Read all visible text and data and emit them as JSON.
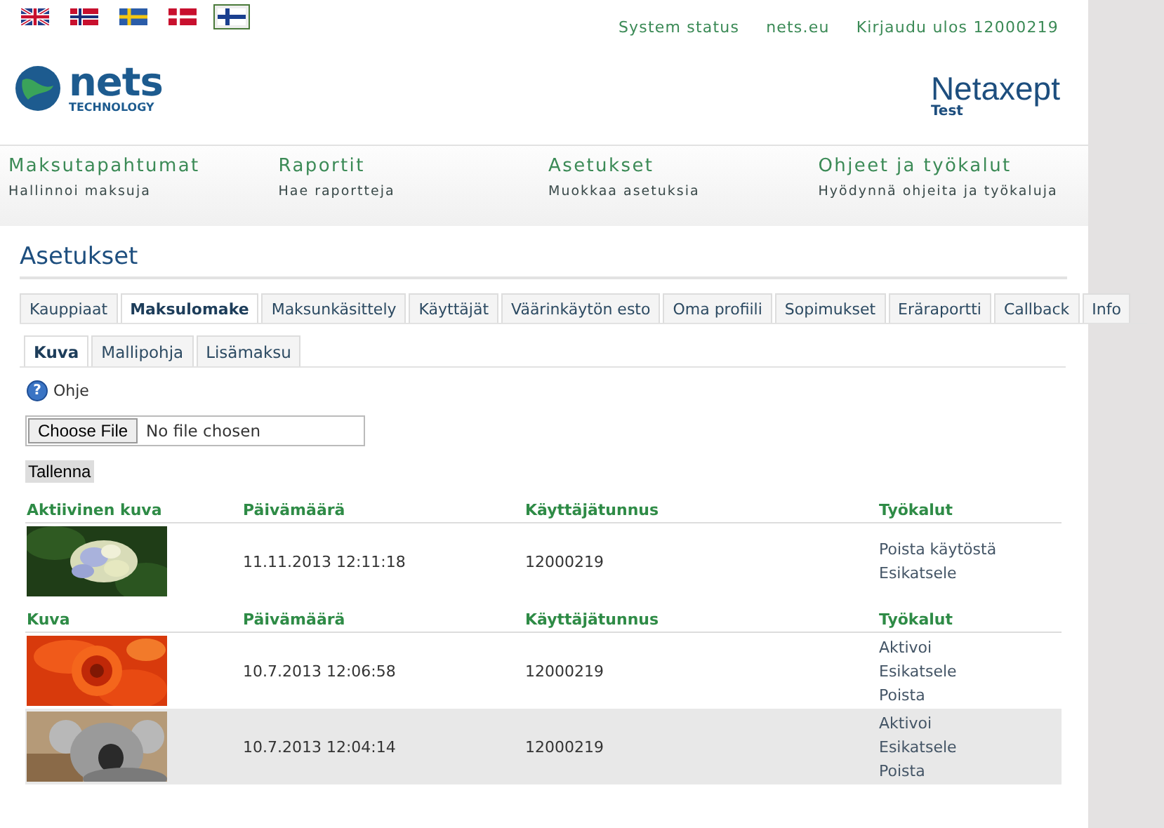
{
  "languages": [
    {
      "kind": "uk",
      "selected": false
    },
    {
      "kind": "no",
      "selected": false
    },
    {
      "kind": "se",
      "selected": false
    },
    {
      "kind": "dk",
      "selected": false
    },
    {
      "kind": "fi",
      "selected": true
    }
  ],
  "top_links": [
    "System status",
    "nets.eu",
    "Kirjaudu ulos 12000219"
  ],
  "logo": {
    "name": "nets",
    "sub": "TECHNOLOGY"
  },
  "product": {
    "name": "Netaxept",
    "env": "Test"
  },
  "nav": [
    {
      "title": "Maksutapahtumat",
      "subtitle": "Hallinnoi maksuja"
    },
    {
      "title": "Raportit",
      "subtitle": "Hae raportteja"
    },
    {
      "title": "Asetukset",
      "subtitle": "Muokkaa asetuksia"
    },
    {
      "title": "Ohjeet ja työkalut",
      "subtitle": "Hyödynnä ohjeita ja työkaluja"
    }
  ],
  "page_title": "Asetukset",
  "tabs": [
    {
      "label": "Kauppiaat",
      "selected": false
    },
    {
      "label": "Maksulomake",
      "selected": true
    },
    {
      "label": "Maksunkäsittely",
      "selected": false
    },
    {
      "label": "Käyttäjät",
      "selected": false
    },
    {
      "label": "Väärinkäytön esto",
      "selected": false
    },
    {
      "label": "Oma profiili",
      "selected": false
    },
    {
      "label": "Sopimukset",
      "selected": false
    },
    {
      "label": "Eräraportti",
      "selected": false
    },
    {
      "label": "Callback",
      "selected": false
    },
    {
      "label": "Info",
      "selected": false
    }
  ],
  "subtabs": [
    {
      "label": "Kuva",
      "selected": true
    },
    {
      "label": "Mallipohja",
      "selected": false
    },
    {
      "label": "Lisämaksu",
      "selected": false
    }
  ],
  "help": {
    "icon": "?",
    "label": "Ohje"
  },
  "file_input": {
    "button": "Choose File",
    "value": "No file chosen"
  },
  "save_button": "Tallenna",
  "tables": [
    {
      "columns": [
        "Aktiivinen kuva",
        "Päivämäärä",
        "Käyttäjätunnus",
        "Työkalut"
      ],
      "rows": [
        {
          "kind": "picture",
          "date": "11.11.2013 12:11:18",
          "user": "12000219",
          "tools": [
            "Poista käytöstä",
            "Esikatsele"
          ],
          "highlighted": false
        }
      ]
    },
    {
      "columns": [
        "Kuva",
        "Päivämäärä",
        "Käyttäjätunnus",
        "Työkalut"
      ],
      "rows": [
        {
          "kind": "picture",
          "date": "10.7.2013 12:06:58",
          "user": "12000219",
          "tools": [
            "Aktivoi",
            "Esikatsele",
            "Poista"
          ],
          "highlighted": false
        },
        {
          "kind": "picture",
          "date": "10.7.2013 12:04:14",
          "user": "12000219",
          "tools": [
            "Aktivoi",
            "Esikatsele",
            "Poista"
          ],
          "highlighted": true
        }
      ]
    }
  ]
}
